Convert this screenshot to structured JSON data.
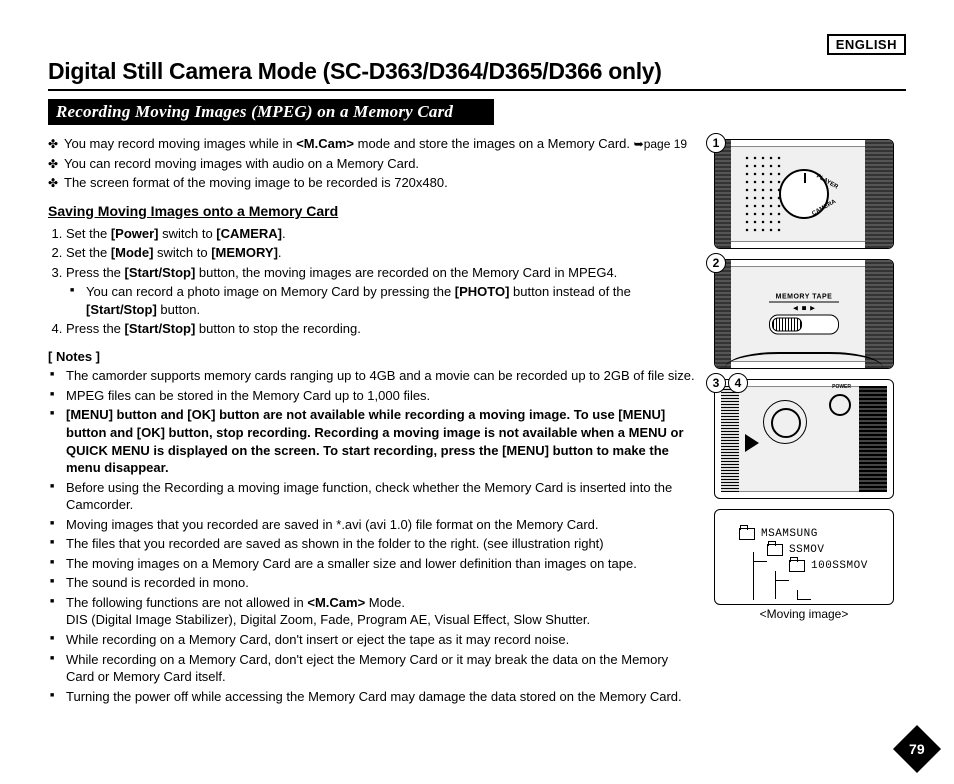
{
  "language_label": "ENGLISH",
  "title": "Digital Still Camera Mode (SC-D363/D364/D365/D366 only)",
  "section_bar": "Recording Moving Images (MPEG) on a Memory Card",
  "intro": [
    {
      "pre": "You may record moving images while in ",
      "bold": "<M.Cam>",
      "post": " mode and store the images on a Memory Card. ",
      "ref": "➥page 19"
    },
    {
      "pre": "You can record moving images with audio on a Memory Card.",
      "bold": "",
      "post": "",
      "ref": ""
    },
    {
      "pre": "The screen format of the moving image to be recorded is 720x480.",
      "bold": "",
      "post": "",
      "ref": ""
    }
  ],
  "sub_heading": "Saving Moving Images onto a Memory Card",
  "steps": {
    "s1": {
      "a": "Set the ",
      "b": "[Power]",
      "c": " switch to ",
      "d": "[CAMERA]",
      "e": "."
    },
    "s2": {
      "a": "Set the ",
      "b": "[Mode]",
      "c": " switch to ",
      "d": "[MEMORY]",
      "e": "."
    },
    "s3": {
      "a": "Press the ",
      "b": "[Start/Stop]",
      "c": " button, the moving images are recorded on the Memory Card in MPEG4."
    },
    "s3sub": {
      "a": "You can record a photo image on Memory Card by pressing the ",
      "b": "[PHOTO]",
      "c": " button instead of the ",
      "d": "[Start/Stop]",
      "e": " button."
    },
    "s4": {
      "a": "Press the ",
      "b": "[Start/Stop]",
      "c": " button to stop the recording."
    }
  },
  "notes_head": "[ Notes ]",
  "notes": [
    "The camorder supports memory cards ranging up to 4GB and a movie can be recorded up to 2GB of file size.",
    "MPEG files can be stored in the Memory Card up to 1,000 files.",
    "__BOLD__[MENU] button and [OK] button are not available while recording a moving image. To use [MENU] button and [OK] button, stop recording. Recording a moving image is not available when a MENU or QUICK MENU is displayed on the screen. To start recording, press the [MENU] button to make the menu disappear.",
    "Before using the Recording a moving image function, check whether the Memory Card is inserted into the Camcorder.",
    "Moving images that you recorded are saved in *.avi (avi 1.0) file format on the Memory Card.",
    "The files that you recorded are saved as shown in the folder to the right. (see illustration right)",
    "The moving images on a Memory Card are a smaller size and lower definition than images on tape.",
    "The sound is recorded in mono.",
    "__MCAM__The following functions are not allowed in <M.Cam> Mode.\nDIS (Digital Image Stabilizer), Digital Zoom, Fade, Program AE, Visual Effect, Slow Shutter.",
    "While recording on a Memory Card, don't insert or eject the tape as it may record noise.",
    "While recording on a Memory Card, don't eject the Memory Card or it may break the data on the Memory Card or Memory Card itself.",
    "Turning the power off while accessing the Memory Card may damage the data stored on the Memory Card."
  ],
  "illus": {
    "dial": {
      "player": "PLAYER",
      "camera": "CAMERA"
    },
    "mode": {
      "label": "MEMORY    TAPE",
      "arrows": "◄ ■ ►"
    },
    "power": "POWER",
    "tree": {
      "root": "MSAMSUNG",
      "sub": "SSMOV",
      "leaf": "100SSMOV"
    },
    "caption": "<Moving image>",
    "badges": {
      "b1": "1",
      "b2": "2",
      "b3": "3",
      "b4": "4"
    }
  },
  "page_number": "79"
}
